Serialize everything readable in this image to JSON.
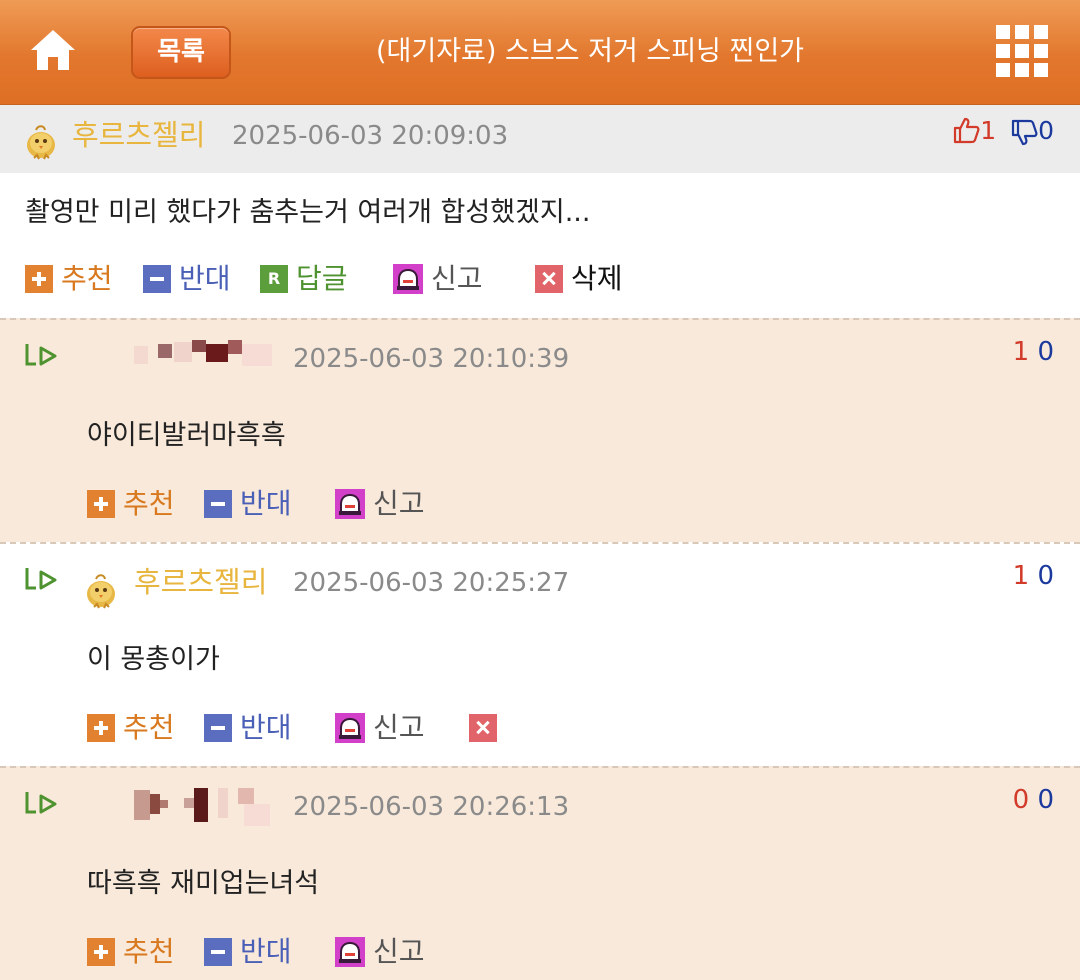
{
  "header": {
    "list_button": "목록",
    "title": "(대기자료) 스브스 저거 스피닝 찐인가",
    "home_icon": "home-icon",
    "menu_icon": "grid-menu-icon",
    "colors": {
      "bar": "#e2772d",
      "button": "#dd5f1f"
    }
  },
  "comments": [
    {
      "nickname": "후르츠젤리",
      "datetime": "2025-06-03 20:09:03",
      "text": "촬영만 미리 했다가 춤추는거 여러개 합성했겠지...",
      "upvotes": "1",
      "downvotes": "0",
      "actions": {
        "recommend": "추천",
        "oppose": "반대",
        "reply": "답글",
        "reply_badge": "R",
        "report": "신고",
        "delete": "삭제"
      }
    },
    {
      "nickname": "",
      "datetime": "2025-06-03 20:10:39",
      "text": "야이티발러마흑흑",
      "upvotes": "1",
      "downvotes": "0",
      "actions": {
        "recommend": "추천",
        "oppose": "반대",
        "report": "신고"
      }
    },
    {
      "nickname": "후르츠젤리",
      "datetime": "2025-06-03 20:25:27",
      "text": "이 몽총이가",
      "upvotes": "1",
      "downvotes": "0",
      "actions": {
        "recommend": "추천",
        "oppose": "반대",
        "report": "신고"
      }
    },
    {
      "nickname": "",
      "datetime": "2025-06-03 20:26:13",
      "text": "따흑흑 재미업는녀석",
      "upvotes": "0",
      "downvotes": "0",
      "actions": {
        "recommend": "추천",
        "oppose": "반대",
        "report": "신고"
      }
    }
  ],
  "colors": {
    "nickname": "#e8b53e",
    "recommend": "#e2812f",
    "oppose": "#5a6dbf",
    "reply": "#5d9e3c",
    "delete": "#e06469",
    "upvote": "#d23a2a",
    "downvote": "#1c3a9e",
    "reply_bg": "#f8e9da"
  }
}
